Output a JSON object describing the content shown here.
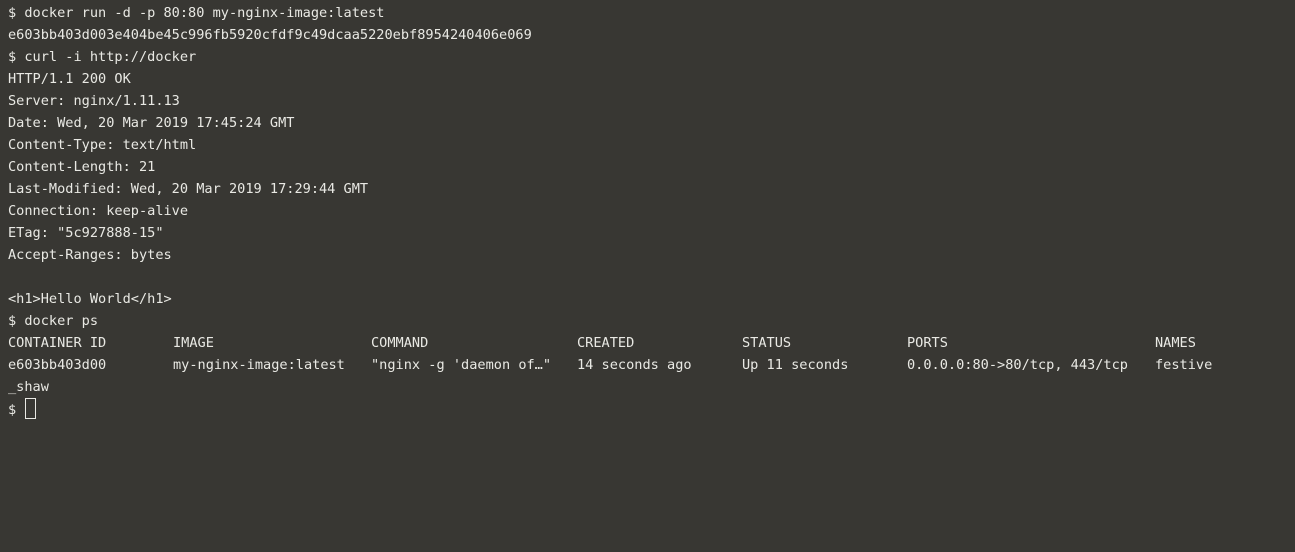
{
  "terminal": {
    "colors": {
      "background": "#383733",
      "foreground": "#e9e9e4"
    },
    "run_cmd": "$ docker run -d -p 80:80 my-nginx-image:latest",
    "container_hash": "e603bb403d003e404be45c996fb5920cfdf9c49dcaa5220ebf8954240406e069",
    "curl_cmd": "$ curl -i http://docker",
    "http_response": [
      "HTTP/1.1 200 OK",
      "Server: nginx/1.11.13",
      "Date: Wed, 20 Mar 2019 17:45:24 GMT",
      "Content-Type: text/html",
      "Content-Length: 21",
      "Last-Modified: Wed, 20 Mar 2019 17:29:44 GMT",
      "Connection: keep-alive",
      "ETag: \"5c927888-15\"",
      "Accept-Ranges: bytes"
    ],
    "body": "<h1>Hello World</h1>",
    "ps_cmd": "$ docker ps",
    "ps_headers": [
      "CONTAINER ID",
      "IMAGE",
      "COMMAND",
      "CREATED",
      "STATUS",
      "PORTS",
      "NAMES"
    ],
    "ps_row": [
      "e603bb403d00",
      "my-nginx-image:latest",
      "\"nginx -g 'daemon of…\"",
      "14 seconds ago",
      "Up 11 seconds",
      "0.0.0.0:80->80/tcp, 443/tcp",
      "festive"
    ],
    "ps_row_wrap": "_shaw",
    "prompt": "$"
  }
}
